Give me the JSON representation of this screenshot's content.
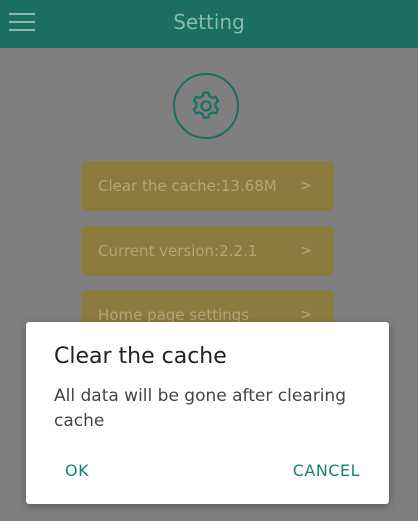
{
  "header": {
    "title": "Setting"
  },
  "settings": {
    "items": [
      {
        "label": "Clear the cache:13.68M",
        "chevron": ">"
      },
      {
        "label": "Current version:2.2.1",
        "chevron": ">"
      },
      {
        "label": "Home page settings",
        "chevron": ">"
      }
    ]
  },
  "dialog": {
    "title": "Clear the cache",
    "message": "All data will be gone after clearing cache",
    "ok_label": "OK",
    "cancel_label": "CANCEL"
  },
  "colors": {
    "primary": "#26a69a",
    "button_bg": "#fbc02d",
    "dim_overlay": "rgba(0,0,0,0.5)",
    "dialog_accent": "#1a7f73"
  },
  "icons": {
    "menu": "hamburger-menu-icon",
    "settings": "gear-icon",
    "chevron": "chevron-right-icon"
  }
}
